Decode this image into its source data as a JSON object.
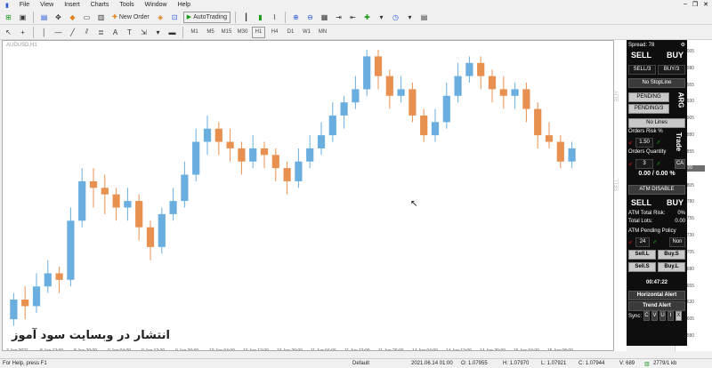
{
  "menu": [
    "File",
    "View",
    "Insert",
    "Charts",
    "Tools",
    "Window",
    "Help"
  ],
  "toolbar": {
    "new_order_label": "New Order",
    "autotrading_label": "AutoTrading"
  },
  "timeframes": [
    "M1",
    "M5",
    "M15",
    "M30",
    "H1",
    "H4",
    "D1",
    "W1",
    "MN"
  ],
  "chart": {
    "title": "AUDUSD,H1",
    "yticks": [
      "1.08005",
      "1.07980",
      "1.07955",
      "1.07930",
      "1.07905",
      "1.07880",
      "1.07855",
      "1.07830",
      "1.07805",
      "1.07780",
      "1.07755",
      "1.07730",
      "1.07705",
      "1.07680",
      "1.07655",
      "1.07630",
      "1.07605",
      "1.07580"
    ],
    "current_price": "1.07920",
    "xticks": [
      "7 Jun 2021",
      "8 Jun 12:00",
      "8 Jun 20:00",
      "9 Jun 04:00",
      "9 Jun 12:00",
      "9 Jun 20:00",
      "10 Jun 04:00",
      "10 Jun 12:00",
      "10 Jun 20:00",
      "11 Jun 04:00",
      "11 Jun 12:00",
      "11 Jun 20:00",
      "14 Jun 04:00",
      "14 Jun 12:00",
      "14 Jun 20:00",
      "15 Jun 04:00",
      "15 Jun 08:00"
    ],
    "watermark": "انتشار در وبسایت سود آموز",
    "side_labels": [
      "SELL",
      "BUY"
    ]
  },
  "chart_data": {
    "type": "candlestick",
    "title": "AUDUSD,H1",
    "ylim": [
      1.0758,
      1.0801
    ],
    "up_color": "#6aaee0",
    "down_color": "#e89050",
    "candles": [
      {
        "o": 1.076,
        "c": 1.0763,
        "h": 1.0764,
        "l": 1.0759
      },
      {
        "o": 1.0763,
        "c": 1.0762,
        "h": 1.0765,
        "l": 1.076
      },
      {
        "o": 1.0762,
        "c": 1.0765,
        "h": 1.0767,
        "l": 1.0761
      },
      {
        "o": 1.0765,
        "c": 1.0767,
        "h": 1.0769,
        "l": 1.0764
      },
      {
        "o": 1.0767,
        "c": 1.0766,
        "h": 1.0768,
        "l": 1.0764
      },
      {
        "o": 1.0766,
        "c": 1.0775,
        "h": 1.0777,
        "l": 1.0765
      },
      {
        "o": 1.0775,
        "c": 1.0781,
        "h": 1.0783,
        "l": 1.0774
      },
      {
        "o": 1.0781,
        "c": 1.078,
        "h": 1.0783,
        "l": 1.0777
      },
      {
        "o": 1.078,
        "c": 1.0779,
        "h": 1.0782,
        "l": 1.0776
      },
      {
        "o": 1.0779,
        "c": 1.0777,
        "h": 1.078,
        "l": 1.0775
      },
      {
        "o": 1.0777,
        "c": 1.0778,
        "h": 1.078,
        "l": 1.0775
      },
      {
        "o": 1.0778,
        "c": 1.0774,
        "h": 1.0779,
        "l": 1.0772
      },
      {
        "o": 1.0774,
        "c": 1.0771,
        "h": 1.0775,
        "l": 1.0769
      },
      {
        "o": 1.0771,
        "c": 1.0776,
        "h": 1.0777,
        "l": 1.077
      },
      {
        "o": 1.0776,
        "c": 1.0778,
        "h": 1.078,
        "l": 1.0775
      },
      {
        "o": 1.0778,
        "c": 1.0782,
        "h": 1.0784,
        "l": 1.0777
      },
      {
        "o": 1.0782,
        "c": 1.0787,
        "h": 1.0789,
        "l": 1.0781
      },
      {
        "o": 1.0787,
        "c": 1.0789,
        "h": 1.0791,
        "l": 1.0785
      },
      {
        "o": 1.0789,
        "c": 1.0787,
        "h": 1.079,
        "l": 1.0785
      },
      {
        "o": 1.0787,
        "c": 1.0786,
        "h": 1.0789,
        "l": 1.0784
      },
      {
        "o": 1.0786,
        "c": 1.0784,
        "h": 1.0787,
        "l": 1.0782
      },
      {
        "o": 1.0784,
        "c": 1.0786,
        "h": 1.0788,
        "l": 1.0783
      },
      {
        "o": 1.0786,
        "c": 1.0785,
        "h": 1.0787,
        "l": 1.0783
      },
      {
        "o": 1.0785,
        "c": 1.0783,
        "h": 1.0786,
        "l": 1.0781
      },
      {
        "o": 1.0783,
        "c": 1.0781,
        "h": 1.0784,
        "l": 1.0779
      },
      {
        "o": 1.0781,
        "c": 1.0784,
        "h": 1.0786,
        "l": 1.078
      },
      {
        "o": 1.0784,
        "c": 1.0786,
        "h": 1.0788,
        "l": 1.0783
      },
      {
        "o": 1.0786,
        "c": 1.0788,
        "h": 1.079,
        "l": 1.0785
      },
      {
        "o": 1.0788,
        "c": 1.0791,
        "h": 1.0793,
        "l": 1.0787
      },
      {
        "o": 1.0791,
        "c": 1.0793,
        "h": 1.0794,
        "l": 1.0789
      },
      {
        "o": 1.0793,
        "c": 1.0795,
        "h": 1.0797,
        "l": 1.0792
      },
      {
        "o": 1.0795,
        "c": 1.08,
        "h": 1.0801,
        "l": 1.0794
      },
      {
        "o": 1.08,
        "c": 1.0797,
        "h": 1.0801,
        "l": 1.0795
      },
      {
        "o": 1.0797,
        "c": 1.0794,
        "h": 1.0798,
        "l": 1.0792
      },
      {
        "o": 1.0794,
        "c": 1.0795,
        "h": 1.0797,
        "l": 1.0793
      },
      {
        "o": 1.0795,
        "c": 1.0791,
        "h": 1.0796,
        "l": 1.079
      },
      {
        "o": 1.0791,
        "c": 1.0788,
        "h": 1.0792,
        "l": 1.0787
      },
      {
        "o": 1.0788,
        "c": 1.079,
        "h": 1.0792,
        "l": 1.0787
      },
      {
        "o": 1.079,
        "c": 1.0794,
        "h": 1.0796,
        "l": 1.0789
      },
      {
        "o": 1.0794,
        "c": 1.0797,
        "h": 1.0799,
        "l": 1.0793
      },
      {
        "o": 1.0797,
        "c": 1.0799,
        "h": 1.08,
        "l": 1.0796
      },
      {
        "o": 1.0799,
        "c": 1.0797,
        "h": 1.08,
        "l": 1.0795
      },
      {
        "o": 1.0797,
        "c": 1.0795,
        "h": 1.0798,
        "l": 1.0793
      },
      {
        "o": 1.0795,
        "c": 1.0794,
        "h": 1.0797,
        "l": 1.0792
      },
      {
        "o": 1.0794,
        "c": 1.0795,
        "h": 1.0796,
        "l": 1.0792
      },
      {
        "o": 1.0795,
        "c": 1.0792,
        "h": 1.0796,
        "l": 1.079
      },
      {
        "o": 1.0792,
        "c": 1.0788,
        "h": 1.0793,
        "l": 1.0786
      },
      {
        "o": 1.0788,
        "c": 1.0787,
        "h": 1.079,
        "l": 1.0786
      },
      {
        "o": 1.0787,
        "c": 1.0784,
        "h": 1.0788,
        "l": 1.0783
      },
      {
        "o": 1.0784,
        "c": 1.0786,
        "h": 1.0787,
        "l": 1.0783
      }
    ]
  },
  "panel": {
    "spread_label": "Spread: 78",
    "sell_label": "SELL",
    "buy_label": "BUY",
    "sell_third": "SELL/3",
    "buy_third": "BUY/3",
    "no_stopline": "No StopLine",
    "pending": "PENDING",
    "pending_third": "PENDING/3",
    "arg": "ARG",
    "no_lines": "No Lines",
    "trade": "Trade",
    "orders_risk": "Orders Risk %",
    "risk_value": "1.50",
    "orders_quantity": "Orders Quantity",
    "quantity_value": "3",
    "ca": "CA",
    "pct_value": "0.00 / 0.00 %",
    "atm_disable": "ATM DISABLE",
    "sell2": "SELL",
    "buy2": "BUY",
    "atm_total_risk_label": "ATM Total Risk:",
    "atm_total_risk_value": "0%",
    "total_lots_label": "Total Lots:",
    "total_lots_value": "0.00",
    "atm_pending_policy": "ATM Pending Policy",
    "pending_value": "24",
    "non": "Non",
    "sell_l": "Sell.L",
    "buy_s": "Buy.S",
    "sell_s": "Sell.S",
    "buy_l": "Buy.L",
    "timer": "00:47:22",
    "horizontal_alert": "Horizontal Alert",
    "trend_alert": "Trend Alert",
    "sync_label": "Sync:",
    "sync_keys": [
      "C",
      "V",
      "U",
      "I",
      "X"
    ]
  },
  "status": {
    "help": "For Help, press F1",
    "profile": "Default",
    "datetime": "2021.06.14 01:00",
    "open": "O: 1.07955",
    "high": "H: 1.07970",
    "low": "L: 1.07921",
    "close": "C: 1.07944",
    "volume": "V: 689",
    "traffic": "2779/1 kb"
  }
}
